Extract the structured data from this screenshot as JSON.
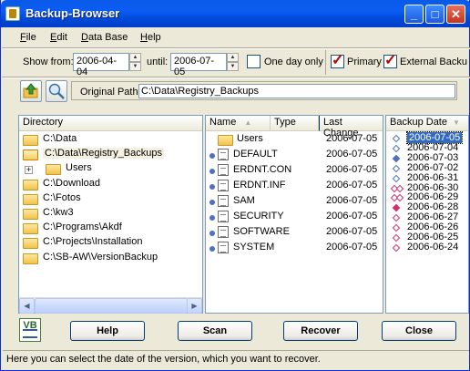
{
  "window": {
    "title": "Backup-Browser"
  },
  "menu": [
    {
      "label": "File",
      "underline": "F",
      "rest": "ile"
    },
    {
      "label": "Edit",
      "underline": "E",
      "rest": "dit"
    },
    {
      "label": "Data Base",
      "underline": "D",
      "rest": "ata Base"
    },
    {
      "label": "Help",
      "underline": "H",
      "rest": "elp"
    }
  ],
  "filter": {
    "show_from_label": "Show from:",
    "from_date": "2006-04-04",
    "until_label": "until:",
    "until_date": "2006-07-05",
    "one_day_label": "One day only",
    "one_day_checked": false,
    "primary_label": "Primary",
    "primary_checked": true,
    "external_label": "External Backu",
    "external_checked": true
  },
  "path": {
    "label": "Original Path",
    "value": "C:\\Data\\Registry_Backups"
  },
  "directory": {
    "header": "Directory",
    "items": [
      {
        "label": "C:\\Data",
        "open": false,
        "child": false
      },
      {
        "label": "C:\\Data\\Registry_Backups",
        "open": true,
        "child": false,
        "selected": true
      },
      {
        "label": "Users",
        "open": false,
        "child": true
      },
      {
        "label": "C:\\Download",
        "open": false,
        "child": false
      },
      {
        "label": "C:\\Fotos",
        "open": false,
        "child": false
      },
      {
        "label": "C:\\kw3",
        "open": false,
        "child": false
      },
      {
        "label": "C:\\Programs\\Akdf",
        "open": false,
        "child": false
      },
      {
        "label": "C:\\Projects\\Installation",
        "open": false,
        "child": false
      },
      {
        "label": "C:\\SB-AW\\VersionBackup",
        "open": false,
        "child": false
      }
    ]
  },
  "files": {
    "columns": {
      "name": "Name",
      "type": "Type",
      "last_change": "Last Change"
    },
    "rows": [
      {
        "name": "Users",
        "kind": "folder",
        "date": "2006-07-05"
      },
      {
        "name": "DEFAULT",
        "kind": "file",
        "date": "2006-07-05"
      },
      {
        "name": "ERDNT.CON",
        "kind": "file",
        "date": "2006-07-05"
      },
      {
        "name": "ERDNT.INF",
        "kind": "file",
        "date": "2006-07-05"
      },
      {
        "name": "SAM",
        "kind": "file",
        "date": "2006-07-05"
      },
      {
        "name": "SECURITY",
        "kind": "file",
        "date": "2006-07-05"
      },
      {
        "name": "SOFTWARE",
        "kind": "file",
        "date": "2006-07-05"
      },
      {
        "name": "SYSTEM",
        "kind": "file",
        "date": "2006-07-05"
      }
    ]
  },
  "backup_dates": {
    "header": "Backup Date",
    "items": [
      {
        "date": "2006-07-05",
        "marker": "blue-outline",
        "selected": true
      },
      {
        "date": "2006-07-04",
        "marker": "blue-outline"
      },
      {
        "date": "2006-07-03",
        "marker": "blue-fill"
      },
      {
        "date": "2006-07-02",
        "marker": "blue-outline"
      },
      {
        "date": "2006-06-31",
        "marker": "blue-outline"
      },
      {
        "date": "2006-06-30",
        "marker": "pink-double"
      },
      {
        "date": "2006-06-29",
        "marker": "pink-double"
      },
      {
        "date": "2006-06-28",
        "marker": "pink-fill"
      },
      {
        "date": "2006-06-27",
        "marker": "pink-outline"
      },
      {
        "date": "2006-06-26",
        "marker": "pink-outline"
      },
      {
        "date": "2006-06-25",
        "marker": "pink-outline"
      },
      {
        "date": "2006-06-24",
        "marker": "pink-outline"
      }
    ]
  },
  "buttons": {
    "logo": "VB",
    "help": "Help",
    "scan": "Scan",
    "recover": "Recover",
    "close": "Close"
  },
  "status": "Here you can select the date of the version, which you want to recover.",
  "colors": {
    "title_blue": "#0b5cf3",
    "selection": "#316ac5",
    "marker_blue": "#4e6fc4",
    "marker_pink": "#d4306e"
  }
}
